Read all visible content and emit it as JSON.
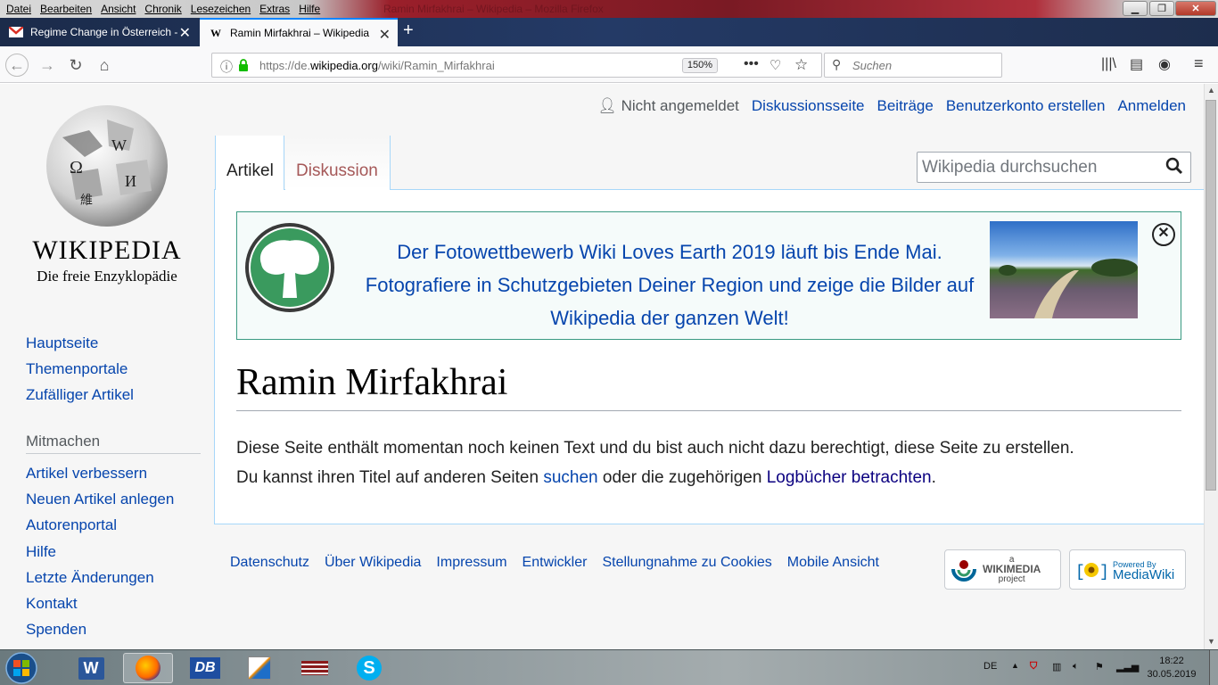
{
  "menu": [
    "Datei",
    "Bearbeiten",
    "Ansicht",
    "Chronik",
    "Lesezeichen",
    "Extras",
    "Hilfe"
  ],
  "window_title": "Ramin Mirfakhrai – Wikipedia – Mozilla Firefox",
  "tabs": [
    {
      "title": "Regime Change in Österreich -",
      "favicon": "gmail-icon"
    },
    {
      "title": "Ramin Mirfakhrai – Wikipedia",
      "favicon": "wikipedia-w-icon"
    }
  ],
  "navbar": {
    "url_prefix": "https://de.",
    "url_domain": "wikipedia.org",
    "url_path": "/wiki/Ramin_Mirfakhrai",
    "zoom": "150%",
    "search_placeholder": "Suchen"
  },
  "wiki": {
    "logo_title": "WIKIPEDIA",
    "logo_subtitle": "Die freie Enzyklopädie",
    "user_links": {
      "not_logged_in": "Nicht angemeldet",
      "talk": "Diskussionsseite",
      "contributions": "Beiträge",
      "create_account": "Benutzerkonto erstellen",
      "login": "Anmelden"
    },
    "tab_article": "Artikel",
    "tab_discussion": "Diskussion",
    "search_placeholder": "Wikipedia durchsuchen",
    "banner": {
      "line1": "Der Fotowettbewerb Wiki Loves Earth 2019 läuft bis Ende Mai.",
      "line2": "Fotografiere in Schutzgebieten Deiner Region und zeige die Bilder auf",
      "line3": "Wikipedia der ganzen Welt!"
    },
    "title": "Ramin Mirfakhrai",
    "body": {
      "part1": "Diese Seite enthält momentan noch keinen Text und du bist auch nicht dazu berechtigt, diese Seite zu erstellen.",
      "part2": "Du kannst ihren Titel auf anderen Seiten ",
      "link_search": "suchen",
      "part3": " oder die zugehörigen ",
      "link_logs": "Logbücher betrachten",
      "part4": "."
    },
    "sidebar": {
      "main": [
        "Hauptseite",
        "Themenportale",
        "Zufälliger Artikel"
      ],
      "section_title": "Mitmachen",
      "contribute": [
        "Artikel verbessern",
        "Neuen Artikel anlegen",
        "Autorenportal",
        "Hilfe",
        "Letzte Änderungen",
        "Kontakt",
        "Spenden"
      ]
    },
    "footer": [
      "Datenschutz",
      "Über Wikipedia",
      "Impressum",
      "Entwickler",
      "Stellungnahme zu Cookies",
      "Mobile Ansicht"
    ],
    "badge_wikimedia_small": "a",
    "badge_wikimedia": "WIKIMEDIA",
    "badge_wikimedia_sub": "project",
    "badge_mediawiki_small": "Powered By",
    "badge_mediawiki": "MediaWiki"
  },
  "taskbar": {
    "language": "DE",
    "time": "18:22",
    "date": "30.05.2019"
  }
}
